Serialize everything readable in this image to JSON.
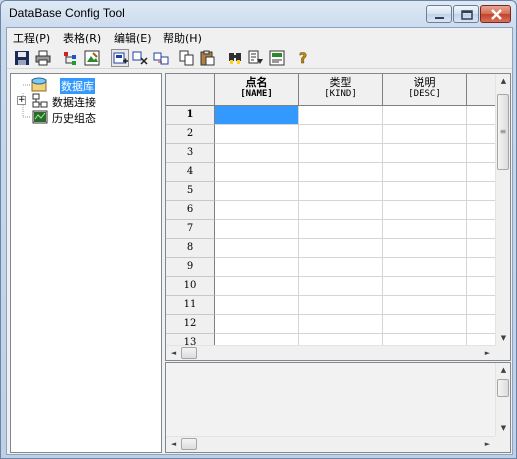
{
  "window": {
    "title": "DataBase Config Tool"
  },
  "menu": [
    {
      "label": "工程(P)"
    },
    {
      "label": "表格(R)"
    },
    {
      "label": "编辑(E)"
    },
    {
      "label": "帮助(H)"
    }
  ],
  "toolbar": [
    {
      "icon": "save-icon"
    },
    {
      "icon": "print-icon"
    },
    {
      "icon": "tree-structure-icon"
    },
    {
      "icon": "image-edit-icon"
    },
    {
      "icon": "insert-row-icon",
      "active": true
    },
    {
      "icon": "cut-row-icon"
    },
    {
      "icon": "move-row-icon"
    },
    {
      "icon": "copy-icon"
    },
    {
      "icon": "paste-icon"
    },
    {
      "icon": "find-icon"
    },
    {
      "icon": "replace-icon"
    },
    {
      "icon": "export-icon"
    },
    {
      "icon": "help-icon"
    }
  ],
  "tree": {
    "items": [
      {
        "label": "数据库",
        "icon": "database-icon",
        "selected": true,
        "expander": false
      },
      {
        "label": "数据连接",
        "icon": "network-icon",
        "selected": false,
        "expander": true
      },
      {
        "label": "历史组态",
        "icon": "history-icon",
        "selected": false,
        "expander": false
      }
    ]
  },
  "grid": {
    "columns": [
      {
        "name": "点名",
        "code": "[NAME]"
      },
      {
        "name": "类型",
        "code": "[KIND]"
      },
      {
        "name": "说明",
        "code": "[DESC]"
      }
    ],
    "rows": [
      "1",
      "2",
      "3",
      "4",
      "5",
      "6",
      "7",
      "8",
      "9",
      "10",
      "11",
      "12",
      "13"
    ]
  },
  "scroll_arrows": {
    "up": "▲",
    "down": "▼",
    "left": "◄",
    "right": "►",
    "grip": "≡"
  },
  "colors": {
    "selection": "#3399ff",
    "close_button": "#c1432b"
  }
}
